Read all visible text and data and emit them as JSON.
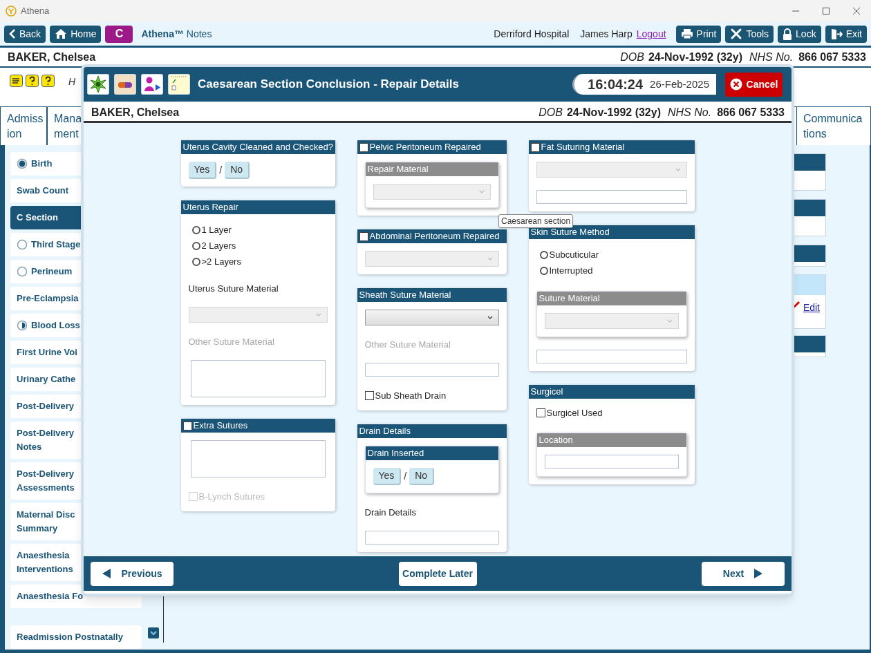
{
  "window": {
    "title": "Athena"
  },
  "toolbar": {
    "left_buttons": [
      {
        "label": "Back"
      },
      {
        "label": "Home"
      }
    ],
    "badge": "C",
    "app_name": "Athena™",
    "app_suffix": "Notes",
    "hospital": "Derriford Hospital",
    "user": "James Harp",
    "logout": "Logout",
    "right_buttons": [
      {
        "label": "Print"
      },
      {
        "label": "Tools"
      },
      {
        "label": "Lock"
      },
      {
        "label": "Exit"
      }
    ]
  },
  "patient": {
    "name": "BAKER, Chelsea",
    "dob_label": "DOB",
    "dob": "24-Nov-1992 (32y)",
    "nhs_label": "NHS No.",
    "nhs": "866 067 5333"
  },
  "banner_text": "H",
  "tabs": [
    {
      "lines": [
        "Admiss",
        "ion"
      ],
      "selected": false
    },
    {
      "lines": [
        "Mana",
        "ment"
      ],
      "selected": false
    },
    {
      "lines": [
        "Communica",
        "tions"
      ],
      "selected": false
    }
  ],
  "sidebar": {
    "items": [
      {
        "lines": [
          "Birth"
        ],
        "kind": "done",
        "selected": false
      },
      {
        "lines": [
          "Swab Count"
        ],
        "kind": "plain",
        "selected": false
      },
      {
        "lines": [
          "C Section"
        ],
        "kind": "plain",
        "selected": true
      },
      {
        "lines": [
          "Third Stage"
        ],
        "kind": "todo",
        "selected": false
      },
      {
        "lines": [
          "Perineum"
        ],
        "kind": "todo",
        "selected": false
      },
      {
        "lines": [
          "Pre-Eclampsia"
        ],
        "kind": "plain",
        "selected": false
      },
      {
        "lines": [
          "Blood Loss"
        ],
        "kind": "partial",
        "selected": false
      },
      {
        "lines": [
          "First Urine Voi"
        ],
        "kind": "plain",
        "selected": false
      },
      {
        "lines": [
          "Urinary Cathe"
        ],
        "kind": "plain",
        "selected": false
      },
      {
        "lines": [
          "Post-Delivery"
        ],
        "kind": "plain",
        "selected": false
      },
      {
        "lines": [
          "Post-Delivery",
          "Notes"
        ],
        "kind": "plain",
        "selected": false
      },
      {
        "lines": [
          "Post-Delivery",
          "Assessments"
        ],
        "kind": "plain",
        "selected": false
      },
      {
        "lines": [
          "Maternal Disc",
          "Summary"
        ],
        "kind": "plain",
        "selected": false
      },
      {
        "lines": [
          "Anaesthesia",
          "Interventions"
        ],
        "kind": "plain",
        "selected": false
      },
      {
        "lines": [
          "Anaesthesia Fo"
        ],
        "kind": "plain",
        "selected": false
      },
      {
        "lines": [
          "Readmission Postnatally"
        ],
        "kind": "plain",
        "selected": false
      }
    ]
  },
  "background_panel": {
    "link": "Edit"
  },
  "modal": {
    "title": "Caesarean Section Conclusion - Repair Details",
    "time": "16:04:24",
    "date": "26-Feb-2025",
    "cancel": "Cancel",
    "patient": {
      "name": "BAKER, Chelsea",
      "dob_label": "DOB",
      "dob": "24-Nov-1992 (32y)",
      "nhs_label": "NHS No.",
      "nhs": "866 067 5333"
    },
    "columns": [
      [
        {
          "title": "Uterus Cavity Cleaned and Checked?",
          "items": [
            {
              "kind": "yesno",
              "options": [
                {
                  "label": "Yes",
                  "selected": false
                },
                {
                  "label": "No",
                  "selected": false
                }
              ],
              "separator": "/"
            }
          ]
        },
        {
          "title": "Uterus Repair",
          "items": [
            {
              "kind": "radio",
              "label": "1 Layer",
              "selected": false
            },
            {
              "kind": "radio",
              "label": "2 Layers",
              "selected": false
            },
            {
              "kind": "radio",
              "label": ">2 Layers",
              "selected": false
            },
            {
              "kind": "label",
              "text": "Uterus Suture Material",
              "disabled": false
            },
            {
              "kind": "select",
              "disabled": true
            },
            {
              "kind": "label",
              "text": "Other Suture Material",
              "disabled": true
            },
            {
              "kind": "textarea"
            }
          ]
        },
        {
          "title": "Extra Sutures",
          "checked": false,
          "items": [
            {
              "kind": "textarea"
            },
            {
              "kind": "checkbox",
              "label": "B-Lynch Sutures",
              "checked": false,
              "disabled": true
            }
          ]
        }
      ],
      [
        {
          "title": "Pelvic Peritoneum Repaired",
          "checked": false,
          "items": [
            {
              "kind": "subpanel",
              "title": "Repair Material",
              "disabled": true,
              "items": [
                {
                  "kind": "select",
                  "disabled": true
                }
              ]
            }
          ]
        },
        {
          "title": "Abdominal Peritoneum Repaired",
          "checked": false,
          "items": [
            {
              "kind": "select",
              "disabled": true
            }
          ]
        },
        {
          "title": "Sheath Suture Material",
          "items": [
            {
              "kind": "select",
              "disabled": false
            },
            {
              "kind": "label",
              "text": "Other Suture Material",
              "disabled": true
            },
            {
              "kind": "input"
            },
            {
              "kind": "checkbox",
              "label": "Sub Sheath Drain",
              "checked": false,
              "disabled": false
            }
          ]
        },
        {
          "title": "Drain Details",
          "items": [
            {
              "kind": "subpanel",
              "title": "Drain Inserted",
              "disabled": false,
              "items": [
                {
                  "kind": "yesno",
                  "options": [
                    {
                      "label": "Yes",
                      "selected": false
                    },
                    {
                      "label": "No",
                      "selected": false
                    }
                  ],
                  "separator": "/"
                }
              ]
            },
            {
              "kind": "label",
              "text": "Drain Details",
              "disabled": false
            },
            {
              "kind": "input"
            }
          ]
        }
      ],
      [
        {
          "title": "Fat Suturing Material",
          "checked": false,
          "items": [
            {
              "kind": "select",
              "disabled": true
            },
            {
              "kind": "input"
            }
          ]
        },
        {
          "title": "Skin Suture Method",
          "items": [
            {
              "kind": "radio",
              "label": "Subcuticular",
              "selected": false
            },
            {
              "kind": "radio",
              "label": "Interrupted",
              "selected": false
            },
            {
              "kind": "subpanel",
              "title": "Suture Material",
              "disabled": true,
              "items": [
                {
                  "kind": "select",
                  "disabled": true
                }
              ]
            },
            {
              "kind": "input"
            }
          ]
        },
        {
          "title": "Surgicel",
          "items": [
            {
              "kind": "checkbox",
              "label": "Surgicel Used",
              "checked": false,
              "disabled": false
            },
            {
              "kind": "subpanel",
              "title": "Location",
              "disabled": true,
              "items": [
                {
                  "kind": "input"
                }
              ]
            }
          ]
        }
      ]
    ],
    "tooltip": "Caesarean section",
    "footer": {
      "previous": "Previous",
      "complete_later": "Complete Later",
      "next": "Next"
    }
  }
}
